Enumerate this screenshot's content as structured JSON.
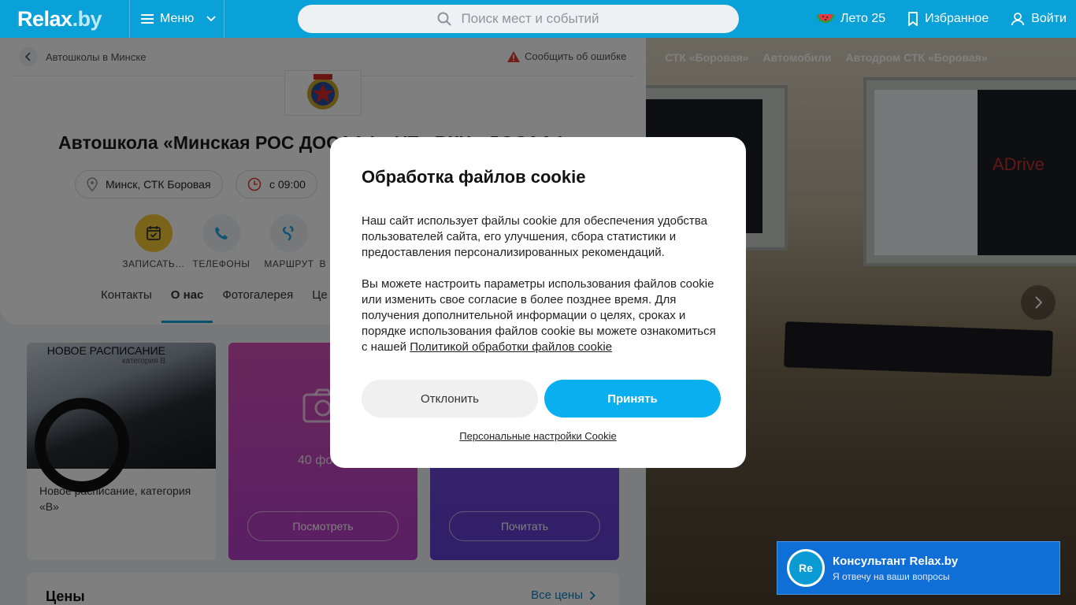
{
  "header": {
    "logo": "Relax",
    "logo_suffix": ".by",
    "menu_label": "Меню",
    "search_placeholder": "Поиск мест и событий",
    "summer_label": "Лето 25",
    "favorites_label": "Избранное",
    "login_label": "Войти"
  },
  "breadcrumb": {
    "label": "Автошколы в Минске",
    "report_label": "Сообщить об ошибке"
  },
  "page": {
    "title": "Автошкола «Минская РОС ДОСААФ» УП «ВКЦ «ДОСААФ»",
    "location_chip": "Минск, СТК Боровая",
    "hours_chip": "с 09:00"
  },
  "actions": [
    {
      "label": "ЗАПИСАТЬ…"
    },
    {
      "label": "ТЕЛЕФОНЫ"
    },
    {
      "label": "МАРШРУТ"
    },
    {
      "label": "В"
    }
  ],
  "tabs": [
    "Контакты",
    "О нас",
    "Фотогалерея",
    "Це"
  ],
  "tiles": {
    "news": {
      "photo_title": "НОВОЕ РАСПИСАНИЕ",
      "photo_subtitle": "категория В",
      "text": "Новое расписание, категория «В»"
    },
    "gallery": {
      "count": "40 фо",
      "button": "Посмотреть"
    },
    "read": {
      "button": "Почитать"
    }
  },
  "prices": {
    "heading": "Цены",
    "all_label": "Все цены"
  },
  "right_panel": {
    "tags": [
      "СТК «Боровая»",
      "Автомобили",
      "Автодром СТК «Боровая»"
    ],
    "screen_brand": "ADrive"
  },
  "cookie_modal": {
    "title": "Обработка файлов cookie",
    "paragraph1": "Наш сайт использует файлы cookie для обеспечения удобства пользователей сайта, его улучшения, сбора статистики и предоставления персонализированных рекомендаций.",
    "paragraph2": "Вы можете настроить параметры использования файлов cookie или изменить свое согласие в более позднее время. Для получения дополнительной информации о целях, сроках и порядке использования файлов cookie вы можете ознакомиться с нашей ",
    "policy_link": "Политикой обработки файлов cookie",
    "decline": "Отклонить",
    "accept": "Принять",
    "personal_settings": "Персональные настройки Cookie"
  },
  "consultant": {
    "avatar": "Re",
    "title": "Консультант Relax.by",
    "subtitle": "Я отвечу на ваши вопросы"
  },
  "colors": {
    "brand": "#0aa0d8",
    "accept": "#0aaff0",
    "consultant": "#0f6fd6"
  }
}
